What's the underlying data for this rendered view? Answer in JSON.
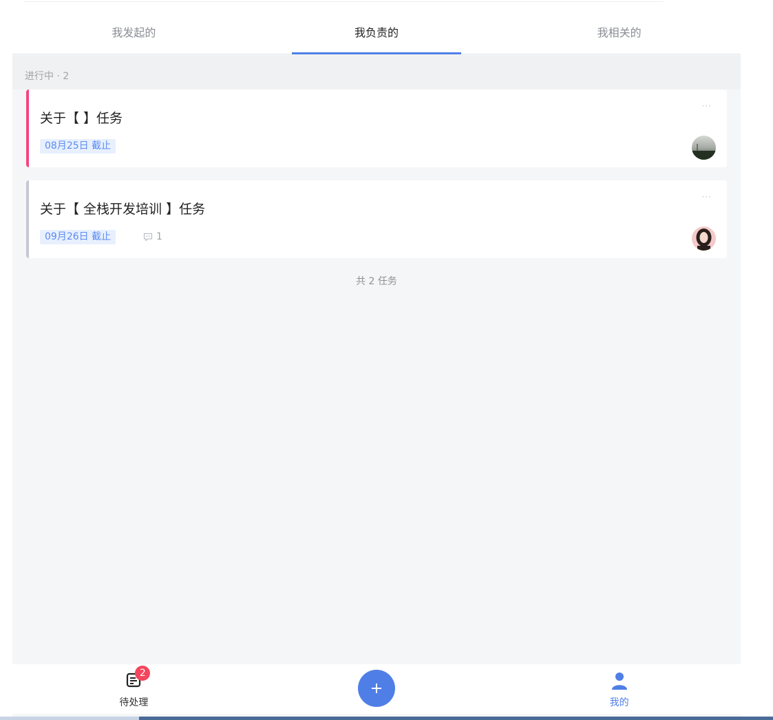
{
  "tabs": [
    {
      "label": "我发起的"
    },
    {
      "label": "我负责的"
    },
    {
      "label": "我相关的"
    }
  ],
  "section": {
    "label": "进行中 · 2"
  },
  "tasks": [
    {
      "title": "关于【 】任务",
      "due": "08月25日 截止",
      "more": "···",
      "accent": "#f5457e",
      "avatar": "photo"
    },
    {
      "title": "关于【 全栈开发培训 】任务",
      "due": "09月26日 截止",
      "more": "···",
      "comments": "1",
      "accent": "#c4c8d4",
      "avatar": "photo"
    }
  ],
  "total": "共 2 任务",
  "nav": {
    "pending": {
      "label": "待处理",
      "badge": "2",
      "icon": "todo-list-icon"
    },
    "add": {
      "icon": "plus-icon"
    },
    "mine": {
      "label": "我的",
      "icon": "user-icon"
    }
  },
  "colors": {
    "primary": "#4f7fe6",
    "badge": "#f5455c"
  }
}
